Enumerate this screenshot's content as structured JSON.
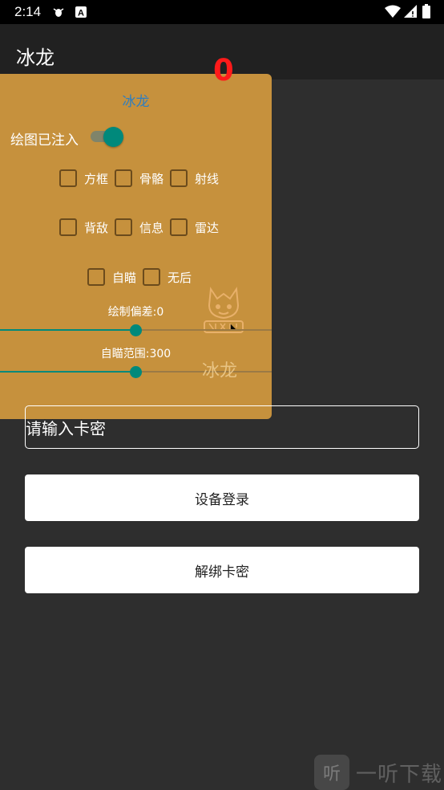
{
  "status_bar": {
    "time": "2:14",
    "icons": [
      "bug-icon",
      "a-letter-icon",
      "wifi-icon",
      "no-data-icon",
      "battery-icon"
    ]
  },
  "app_bar": {
    "title": "冰龙"
  },
  "float_panel": {
    "title": "冰龙",
    "counter": "0",
    "switch": {
      "label": "绘图已注入",
      "checked": true
    },
    "checkbox_rows": [
      [
        {
          "label": "方框",
          "checked": false
        },
        {
          "label": "骨骼",
          "checked": false
        },
        {
          "label": "射线",
          "checked": false
        }
      ],
      [
        {
          "label": "背敌",
          "checked": false
        },
        {
          "label": "信息",
          "checked": false
        },
        {
          "label": "雷达",
          "checked": false
        }
      ],
      [
        {
          "label": "自瞄",
          "checked": false
        },
        {
          "label": "无后",
          "checked": false
        }
      ]
    ],
    "sliders": [
      {
        "label": "绘制偏差:0",
        "fraction": 0.5
      },
      {
        "label": "自瞄范围:300",
        "fraction": 0.5
      }
    ],
    "watermark": "冰龙"
  },
  "card_input": {
    "placeholder": "请输入卡密"
  },
  "buttons": {
    "login": "设备登录",
    "unbind": "解绑卡密"
  },
  "corner_watermark": {
    "icon_text": "听",
    "text": "一听下载"
  },
  "colors": {
    "accent": "#00897b",
    "panel": "#c6913d",
    "title_blue": "#2f7ec0",
    "counter_red": "#ff1a1a"
  }
}
